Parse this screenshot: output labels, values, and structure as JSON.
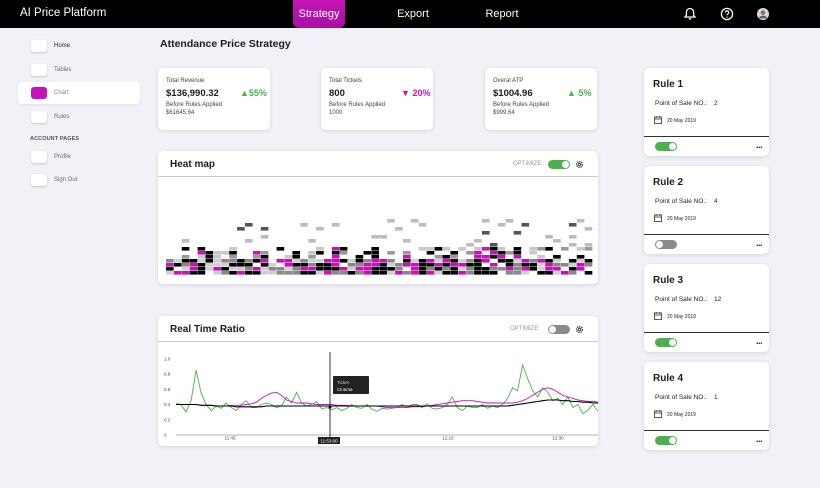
{
  "app": {
    "title": "AI Price Platform"
  },
  "nav": {
    "tabs": [
      {
        "label": "Strategy"
      },
      {
        "label": "Export"
      },
      {
        "label": "Report"
      }
    ]
  },
  "sidebar": {
    "items": [
      {
        "label": "Home",
        "icon": "home-icon"
      },
      {
        "label": "Tables",
        "icon": "tables-icon"
      },
      {
        "label": "Chart",
        "icon": "chart-icon"
      },
      {
        "label": "Rules",
        "icon": "rules-icon"
      }
    ],
    "section_label": "ACCOUNT PAGES",
    "account_items": [
      {
        "label": "Profile",
        "icon": "profile-icon"
      },
      {
        "label": "Sign Out",
        "icon": "sign-out-icon"
      }
    ]
  },
  "page": {
    "title": "Attendance Price Strategy"
  },
  "stats": [
    {
      "label": "Total Revenue",
      "value": "$136,990.32",
      "change": "55%",
      "direction": "up",
      "sub_label": "Before Rules Applied",
      "prev_value": "$61645.64"
    },
    {
      "label": "Total Tickets",
      "value": "800",
      "change": "20%",
      "direction": "down",
      "sub_label": "Before Rules Applied",
      "prev_value": "1000"
    },
    {
      "label": "Overal ATP",
      "value": "$1004.96",
      "change": "5%",
      "direction": "up",
      "sub_label": "Before Rules Applied",
      "prev_value": "$999.64"
    }
  ],
  "heatmap": {
    "title": "Heat map",
    "optimize_label": "OPTIMIZE",
    "optimize_on": true
  },
  "ratio": {
    "title": "Real Time Ratio",
    "optimize_label": "OPTIMIZE",
    "optimize_on": false,
    "tooltip": {
      "line1": "Ticket",
      "line2": "Cinema"
    },
    "cursor_label": "11:53:00"
  },
  "chart_data": {
    "type": "line",
    "y_ticks": [
      "1.0",
      "0.8",
      "0.6",
      "0.4",
      "0.2",
      "0"
    ],
    "x_ticks": [
      "11:45",
      "12:15",
      "12:30"
    ],
    "ylim": [
      0,
      1.05
    ],
    "series": [
      {
        "color": "#4caf50",
        "values": [
          0.42,
          0.4,
          0.3,
          0.45,
          0.85,
          0.55,
          0.4,
          0.32,
          0.38,
          0.35,
          0.42,
          0.36,
          0.32,
          0.4,
          0.45,
          0.36,
          0.36,
          0.4,
          0.42,
          0.4,
          0.36,
          0.38,
          0.5,
          0.42,
          0.56,
          0.42,
          0.38,
          0.4,
          0.44,
          0.34,
          0.36,
          0.33,
          0.36,
          0.32,
          0.35,
          0.4,
          0.36,
          0.35,
          0.4,
          0.34,
          0.31,
          0.35,
          0.34,
          0.35,
          0.36,
          0.4,
          0.36,
          0.4,
          0.4,
          0.36,
          0.41,
          0.35,
          0.34,
          0.36,
          0.4,
          0.5,
          0.36,
          0.32,
          0.38,
          0.36,
          0.36,
          0.4,
          0.35,
          0.38,
          0.36,
          0.4,
          0.48,
          0.62,
          0.58,
          0.92,
          0.74,
          0.58,
          0.5,
          0.62,
          0.56,
          0.45,
          0.48,
          0.4,
          0.5,
          0.36,
          0.4,
          0.28,
          0.33,
          0.4,
          0.31
        ]
      },
      {
        "color": "#c414b7",
        "values": [
          0.4,
          0.4,
          0.4,
          0.4,
          0.4,
          0.39,
          0.39,
          0.39,
          0.38,
          0.38,
          0.38,
          0.39,
          0.39,
          0.39,
          0.4,
          0.41,
          0.43,
          0.48,
          0.52,
          0.55,
          0.56,
          0.52,
          0.46,
          0.44,
          0.42,
          0.42,
          0.42,
          0.41,
          0.4,
          0.4,
          0.4,
          0.4,
          0.39,
          0.39,
          0.39,
          0.38,
          0.38,
          0.38,
          0.38,
          0.38,
          0.38,
          0.37,
          0.36,
          0.36,
          0.36,
          0.36,
          0.36,
          0.37,
          0.37,
          0.37,
          0.38,
          0.39,
          0.4,
          0.41,
          0.42,
          0.43,
          0.44,
          0.45,
          0.45,
          0.45,
          0.44,
          0.43,
          0.42,
          0.42,
          0.42,
          0.42,
          0.42,
          0.42,
          0.43,
          0.45,
          0.48,
          0.52,
          0.56,
          0.6,
          0.62,
          0.6,
          0.56,
          0.52,
          0.5,
          0.48,
          0.46,
          0.45,
          0.44,
          0.44,
          0.43
        ]
      },
      {
        "color": "#000000",
        "values": [
          0.4,
          0.4,
          0.4,
          0.4,
          0.4,
          0.39,
          0.39,
          0.39,
          0.38,
          0.38,
          0.38,
          0.38,
          0.37,
          0.37,
          0.37,
          0.37,
          0.37,
          0.37,
          0.38,
          0.38,
          0.38,
          0.38,
          0.38,
          0.38,
          0.38,
          0.38,
          0.38,
          0.38,
          0.38,
          0.38,
          0.38,
          0.38,
          0.38,
          0.38,
          0.38,
          0.38,
          0.38,
          0.38,
          0.38,
          0.38,
          0.38,
          0.38,
          0.38,
          0.38,
          0.38,
          0.38,
          0.38,
          0.38,
          0.38,
          0.38,
          0.38,
          0.38,
          0.38,
          0.38,
          0.38,
          0.38,
          0.38,
          0.38,
          0.38,
          0.38,
          0.38,
          0.38,
          0.38,
          0.38,
          0.38,
          0.38,
          0.38,
          0.39,
          0.4,
          0.41,
          0.42,
          0.43,
          0.44,
          0.45,
          0.46,
          0.46,
          0.46,
          0.45,
          0.45,
          0.44,
          0.44,
          0.43,
          0.43,
          0.42,
          0.42
        ]
      }
    ]
  },
  "rules": [
    {
      "title": "Rule 1",
      "pos_label": "Point of Sale NO.:",
      "pos_value": "2",
      "date": "20 May 2019",
      "enabled": true
    },
    {
      "title": "Rule 2",
      "pos_label": "Point of Sale NO.:",
      "pos_value": "4",
      "date": "20 May 2019",
      "enabled": false
    },
    {
      "title": "Rule 3",
      "pos_label": "Point of Sale NO.:",
      "pos_value": "12",
      "date": "20 May 2019",
      "enabled": true
    },
    {
      "title": "Rule 4",
      "pos_label": "Point of Sale NO.:",
      "pos_value": "1",
      "date": "20 May 2019",
      "enabled": true
    }
  ],
  "more_label": "..."
}
